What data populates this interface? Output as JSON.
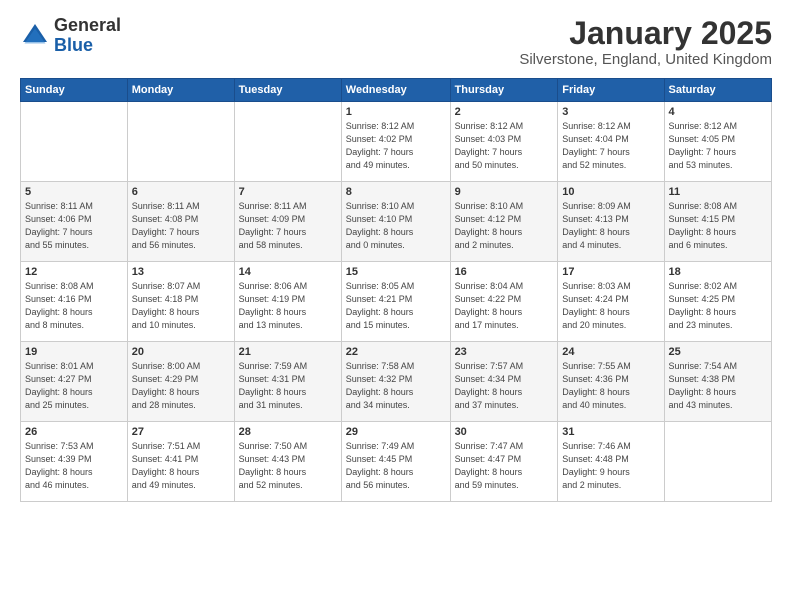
{
  "header": {
    "logo_general": "General",
    "logo_blue": "Blue",
    "month_title": "January 2025",
    "location": "Silverstone, England, United Kingdom"
  },
  "weekdays": [
    "Sunday",
    "Monday",
    "Tuesday",
    "Wednesday",
    "Thursday",
    "Friday",
    "Saturday"
  ],
  "weeks": [
    [
      {
        "day": "",
        "info": ""
      },
      {
        "day": "",
        "info": ""
      },
      {
        "day": "",
        "info": ""
      },
      {
        "day": "1",
        "info": "Sunrise: 8:12 AM\nSunset: 4:02 PM\nDaylight: 7 hours\nand 49 minutes."
      },
      {
        "day": "2",
        "info": "Sunrise: 8:12 AM\nSunset: 4:03 PM\nDaylight: 7 hours\nand 50 minutes."
      },
      {
        "day": "3",
        "info": "Sunrise: 8:12 AM\nSunset: 4:04 PM\nDaylight: 7 hours\nand 52 minutes."
      },
      {
        "day": "4",
        "info": "Sunrise: 8:12 AM\nSunset: 4:05 PM\nDaylight: 7 hours\nand 53 minutes."
      }
    ],
    [
      {
        "day": "5",
        "info": "Sunrise: 8:11 AM\nSunset: 4:06 PM\nDaylight: 7 hours\nand 55 minutes."
      },
      {
        "day": "6",
        "info": "Sunrise: 8:11 AM\nSunset: 4:08 PM\nDaylight: 7 hours\nand 56 minutes."
      },
      {
        "day": "7",
        "info": "Sunrise: 8:11 AM\nSunset: 4:09 PM\nDaylight: 7 hours\nand 58 minutes."
      },
      {
        "day": "8",
        "info": "Sunrise: 8:10 AM\nSunset: 4:10 PM\nDaylight: 8 hours\nand 0 minutes."
      },
      {
        "day": "9",
        "info": "Sunrise: 8:10 AM\nSunset: 4:12 PM\nDaylight: 8 hours\nand 2 minutes."
      },
      {
        "day": "10",
        "info": "Sunrise: 8:09 AM\nSunset: 4:13 PM\nDaylight: 8 hours\nand 4 minutes."
      },
      {
        "day": "11",
        "info": "Sunrise: 8:08 AM\nSunset: 4:15 PM\nDaylight: 8 hours\nand 6 minutes."
      }
    ],
    [
      {
        "day": "12",
        "info": "Sunrise: 8:08 AM\nSunset: 4:16 PM\nDaylight: 8 hours\nand 8 minutes."
      },
      {
        "day": "13",
        "info": "Sunrise: 8:07 AM\nSunset: 4:18 PM\nDaylight: 8 hours\nand 10 minutes."
      },
      {
        "day": "14",
        "info": "Sunrise: 8:06 AM\nSunset: 4:19 PM\nDaylight: 8 hours\nand 13 minutes."
      },
      {
        "day": "15",
        "info": "Sunrise: 8:05 AM\nSunset: 4:21 PM\nDaylight: 8 hours\nand 15 minutes."
      },
      {
        "day": "16",
        "info": "Sunrise: 8:04 AM\nSunset: 4:22 PM\nDaylight: 8 hours\nand 17 minutes."
      },
      {
        "day": "17",
        "info": "Sunrise: 8:03 AM\nSunset: 4:24 PM\nDaylight: 8 hours\nand 20 minutes."
      },
      {
        "day": "18",
        "info": "Sunrise: 8:02 AM\nSunset: 4:25 PM\nDaylight: 8 hours\nand 23 minutes."
      }
    ],
    [
      {
        "day": "19",
        "info": "Sunrise: 8:01 AM\nSunset: 4:27 PM\nDaylight: 8 hours\nand 25 minutes."
      },
      {
        "day": "20",
        "info": "Sunrise: 8:00 AM\nSunset: 4:29 PM\nDaylight: 8 hours\nand 28 minutes."
      },
      {
        "day": "21",
        "info": "Sunrise: 7:59 AM\nSunset: 4:31 PM\nDaylight: 8 hours\nand 31 minutes."
      },
      {
        "day": "22",
        "info": "Sunrise: 7:58 AM\nSunset: 4:32 PM\nDaylight: 8 hours\nand 34 minutes."
      },
      {
        "day": "23",
        "info": "Sunrise: 7:57 AM\nSunset: 4:34 PM\nDaylight: 8 hours\nand 37 minutes."
      },
      {
        "day": "24",
        "info": "Sunrise: 7:55 AM\nSunset: 4:36 PM\nDaylight: 8 hours\nand 40 minutes."
      },
      {
        "day": "25",
        "info": "Sunrise: 7:54 AM\nSunset: 4:38 PM\nDaylight: 8 hours\nand 43 minutes."
      }
    ],
    [
      {
        "day": "26",
        "info": "Sunrise: 7:53 AM\nSunset: 4:39 PM\nDaylight: 8 hours\nand 46 minutes."
      },
      {
        "day": "27",
        "info": "Sunrise: 7:51 AM\nSunset: 4:41 PM\nDaylight: 8 hours\nand 49 minutes."
      },
      {
        "day": "28",
        "info": "Sunrise: 7:50 AM\nSunset: 4:43 PM\nDaylight: 8 hours\nand 52 minutes."
      },
      {
        "day": "29",
        "info": "Sunrise: 7:49 AM\nSunset: 4:45 PM\nDaylight: 8 hours\nand 56 minutes."
      },
      {
        "day": "30",
        "info": "Sunrise: 7:47 AM\nSunset: 4:47 PM\nDaylight: 8 hours\nand 59 minutes."
      },
      {
        "day": "31",
        "info": "Sunrise: 7:46 AM\nSunset: 4:48 PM\nDaylight: 9 hours\nand 2 minutes."
      },
      {
        "day": "",
        "info": ""
      }
    ]
  ]
}
